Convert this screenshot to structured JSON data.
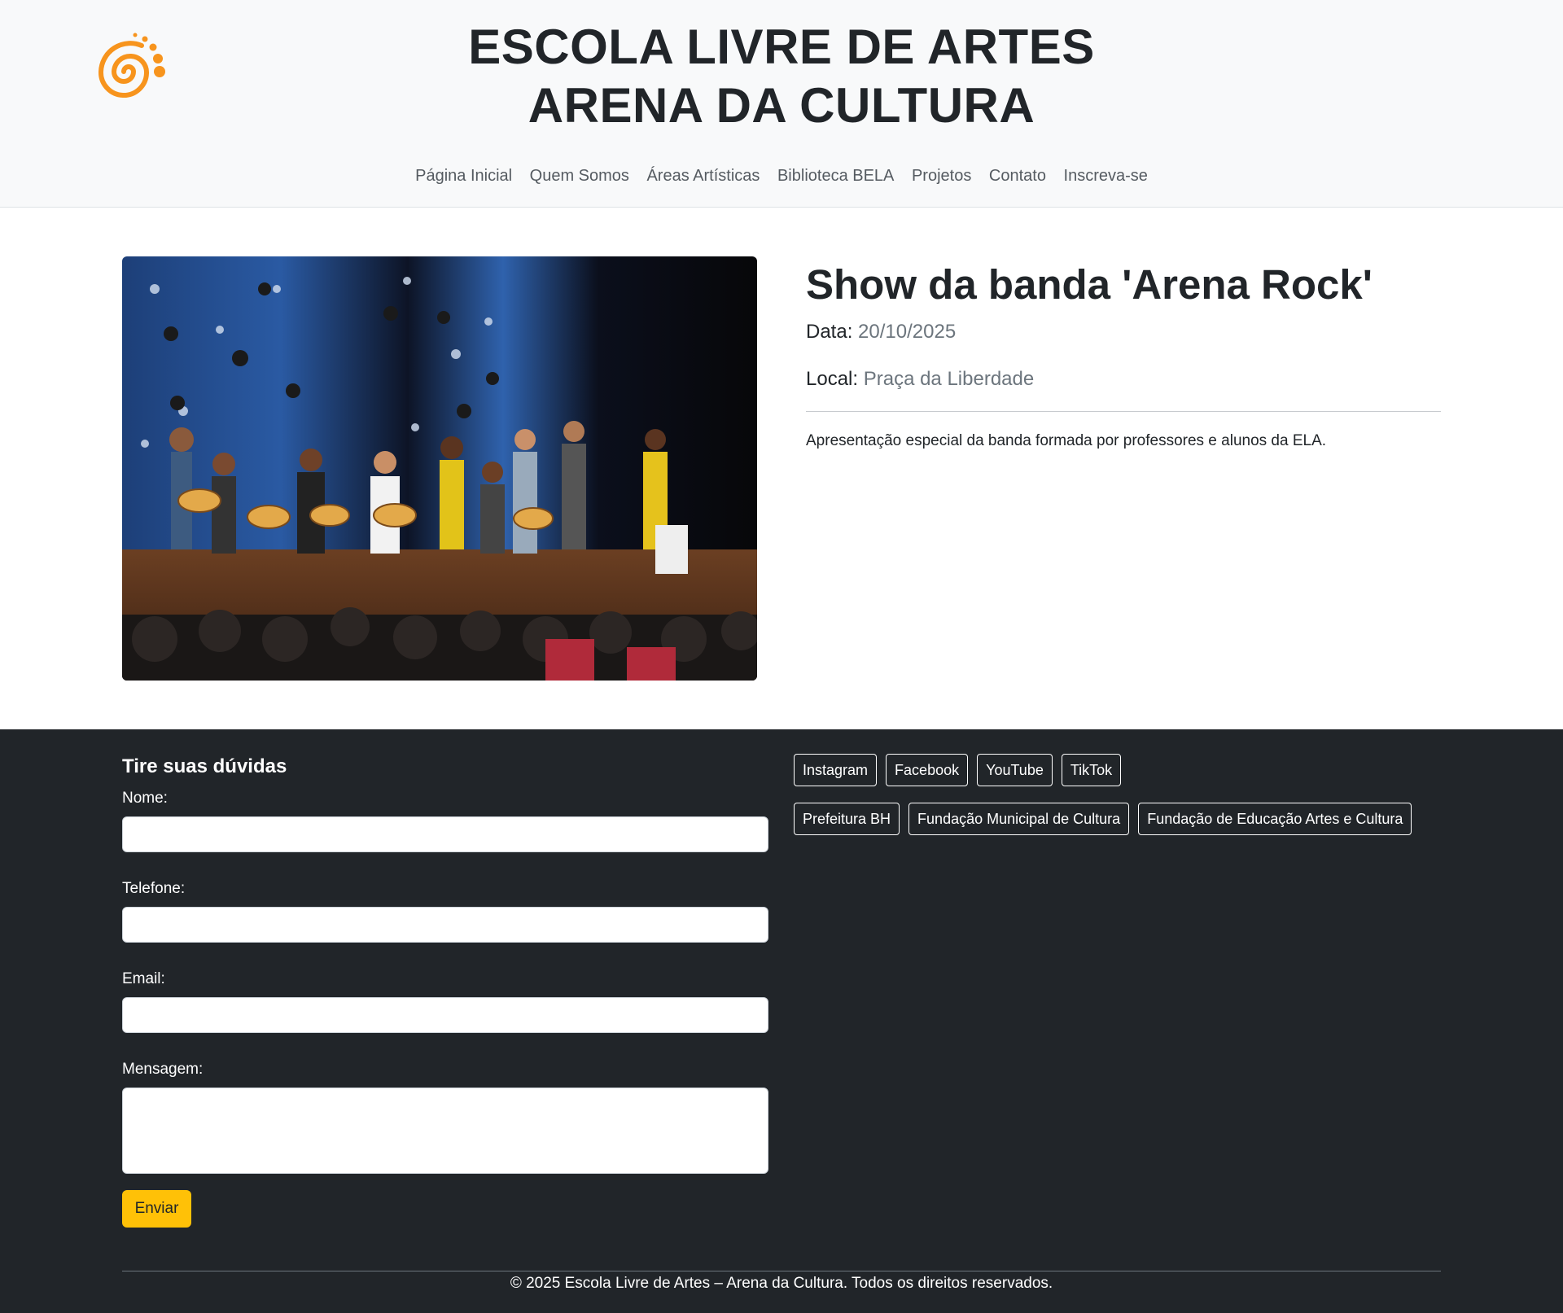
{
  "header": {
    "title_line1": "ESCOLA LIVRE DE ARTES",
    "title_line2": "ARENA DA CULTURA",
    "logo_icon": "spiral-logo-icon",
    "brand_color": "#f7941d",
    "nav": [
      "Página Inicial",
      "Quem Somos",
      "Áreas Artísticas",
      "Biblioteca BELA",
      "Projetos",
      "Contato",
      "Inscreva-se"
    ]
  },
  "event": {
    "title": "Show da banda 'Arena Rock'",
    "date_label": "Data:",
    "date_value": "20/10/2025",
    "place_label": "Local:",
    "place_value": "Praça da Liberdade",
    "description": "Apresentação especial da banda formada por professores e alunos da ELA."
  },
  "contact_form": {
    "heading": "Tire suas dúvidas",
    "name_label": "Nome:",
    "phone_label": "Telefone:",
    "email_label": "Email:",
    "message_label": "Mensagem:",
    "submit_label": "Enviar",
    "submit_color": "#ffc107"
  },
  "links": {
    "social": [
      "Instagram",
      "Facebook",
      "YouTube",
      "TikTok"
    ],
    "partners": [
      "Prefeitura BH",
      "Fundação Municipal de Cultura",
      "Fundação de Educação Artes e Cultura"
    ]
  },
  "footer": {
    "copyright": "© 2025 Escola Livre de Artes – Arena da Cultura. Todos os direitos reservados.",
    "bg_color": "#212529"
  }
}
